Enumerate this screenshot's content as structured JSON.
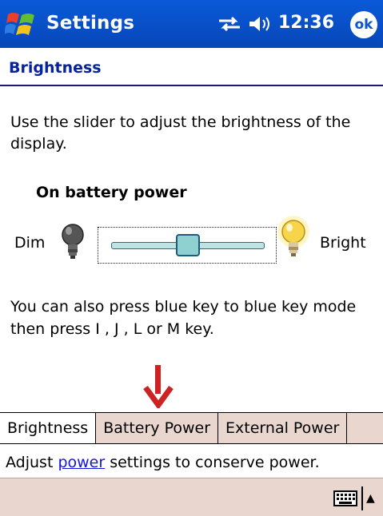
{
  "titlebar": {
    "title": "Settings",
    "time": "12:36",
    "ok_label": "ok",
    "icons": [
      "windows-start-icon",
      "connectivity-icon",
      "volume-icon"
    ]
  },
  "page": {
    "heading": "Brightness",
    "description": "Use the slider to adjust the brightness of the display.",
    "section_heading": "On battery power",
    "slider": {
      "min_label": "Dim",
      "max_label": "Bright",
      "value_fraction": 0.5
    },
    "note": "You can also press blue key to blue key mode then press I , J , L or M key."
  },
  "tabs": [
    {
      "label": "Brightness",
      "active": true
    },
    {
      "label": "Battery Power",
      "active": false
    },
    {
      "label": "External Power",
      "active": false
    }
  ],
  "status": {
    "prefix": "Adjust ",
    "link": "power",
    "suffix": " settings to conserve power."
  },
  "menubar": {
    "icons": [
      "keyboard-icon",
      "sip-up-arrow-icon"
    ],
    "sip_arrow": "▲"
  },
  "colors": {
    "titlebar": "#0a55cf",
    "heading": "#07239c",
    "tabbar": "#e9d6cf",
    "link": "#1414dc",
    "annotation_arrow": "#cc2222"
  }
}
